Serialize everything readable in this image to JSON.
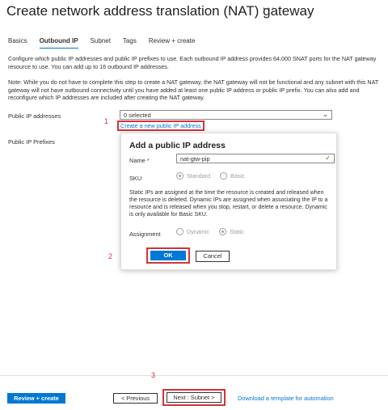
{
  "page": {
    "title": "Create network address translation (NAT) gateway",
    "more": "···"
  },
  "tabs": [
    {
      "label": "Basics"
    },
    {
      "label": "Outbound IP"
    },
    {
      "label": "Subnet"
    },
    {
      "label": "Tags"
    },
    {
      "label": "Review + create"
    }
  ],
  "active_tab": "Outbound IP",
  "description": "Configure which public IP addresses and public IP prefixes to use. Each outbound IP address provides 64,000 SNAT ports for the NAT gateway resource to use. You can add up to 16 outbound IP addresses.",
  "note": "Note: While you do not have to complete this step to create a NAT gateway, the NAT gateway will not be functional and any subnet with this NAT gateway will not have outbound connectivity until you have added at least one public IP address or public IP prefix. You can also add and reconfigure which IP addresses are included after creating the NAT gateway.",
  "public_ip": {
    "label": "Public IP addresses",
    "selected": "0 selected",
    "create_link": "Create a new public IP address"
  },
  "public_ip_prefix": {
    "label": "Public IP Prefixes"
  },
  "dialog": {
    "title": "Add a public IP address",
    "name_label": "Name",
    "required_marker": "*",
    "name_value": "nat-gtw-pip",
    "sku_label": "SKU",
    "sku_options": [
      "Standard",
      "Basic"
    ],
    "sku_selected": "Standard",
    "info_text": "Static IPs are assigned at the time the resource is created and released when the resource is deleted. Dynamic IPs are assigned when associating the IP to a resource and is released when you stop, restart, or delete a resource. Dynamic is only available for Basic SKU.",
    "assignment_label": "Assignment",
    "assignment_options": [
      "Dynamic",
      "Static"
    ],
    "assignment_selected": "Static",
    "ok_label": "OK",
    "cancel_label": "Cancel"
  },
  "footer": {
    "review_label": "Review + create",
    "prev_label": "< Previous",
    "next_label": "Next : Subnet >",
    "download_label": "Download a template for automation"
  },
  "steps": [
    "1",
    "2",
    "3"
  ],
  "colors": {
    "accent": "#0078d4",
    "highlight": "#d13438"
  }
}
